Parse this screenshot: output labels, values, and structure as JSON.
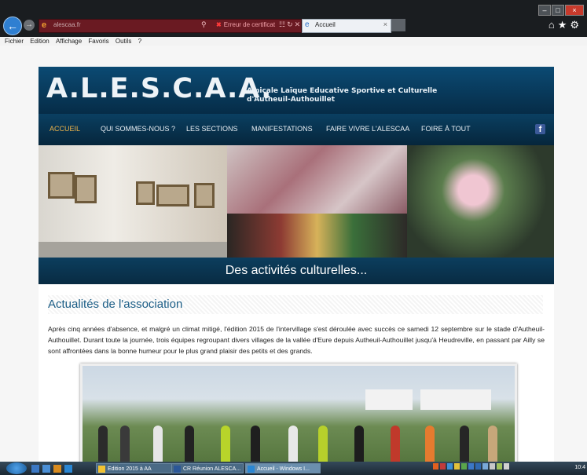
{
  "browser": {
    "address_url": "alescaa.fr",
    "cert_error": "Erreur de certificat",
    "tab_title": "Accueil",
    "menu": [
      "Fichier",
      "Edition",
      "Affichage",
      "Favoris",
      "Outils",
      "?"
    ]
  },
  "site": {
    "logo": "A.L.E.S.C.A.A.",
    "tagline_line1": "Amicale Laïque Educative Sportive et Culturelle",
    "tagline_line2": "d'Autheuil-Authouillet",
    "nav": [
      "ACCUEIL",
      "QUI SOMMES-NOUS ?",
      "LES SECTIONS",
      "MANIFESTATIONS",
      "FAIRE VIVRE L'ALESCAA",
      "FOIRE À TOUT"
    ],
    "banner_caption": "Des activités culturelles...",
    "section_title": "Actualités de l'association",
    "article": "Après cinq années d'absence, et malgré un climat mitigé, l'édition 2015 de l'intervillage s'est déroulée avec succès ce samedi 12 septembre sur le stade d'Autheuil-Authouillet. Durant toute la journée, trois équipes regroupant divers villages de la vallée d'Eure depuis Autheuil-Authouillet jusqu'à Heudreville, en passant par Ailly se sont affrontées dans la bonne humeur pour le plus grand plaisir des petits et des grands."
  },
  "taskbar": {
    "tasks": [
      "Edition 2015 à AA",
      "CR Réunion ALESCA...",
      "Accueil - Windows I..."
    ],
    "clock": "10:4"
  },
  "colors": {
    "header_blue": "#0b4a73",
    "nav_active": "#f0b54a",
    "title_blue": "#1b5d86"
  }
}
